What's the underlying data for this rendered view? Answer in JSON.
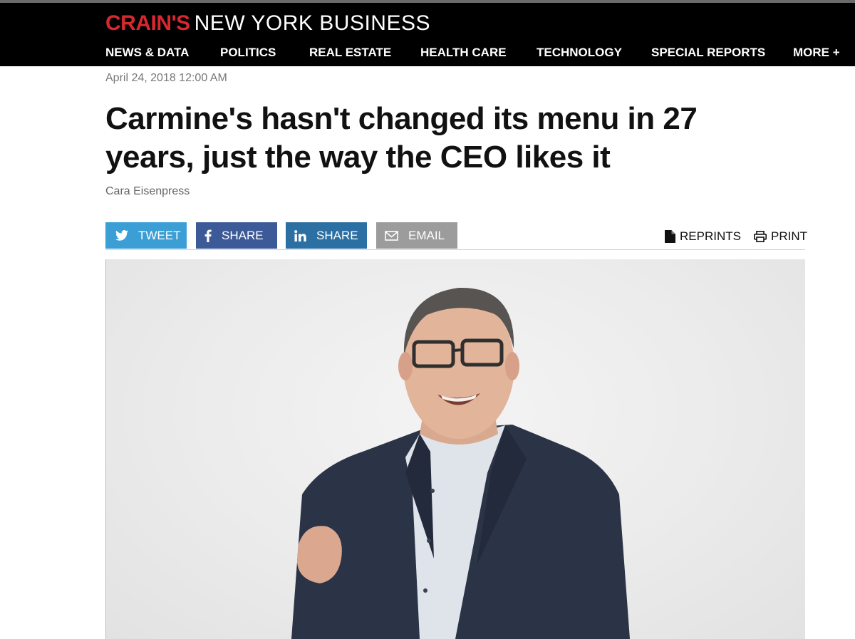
{
  "brand": {
    "name_bold": "CRAIN'S",
    "name_rest": "NEW YORK BUSINESS"
  },
  "nav": {
    "items": [
      "NEWS & DATA",
      "POLITICS",
      "REAL ESTATE",
      "HEALTH CARE",
      "TECHNOLOGY",
      "SPECIAL REPORTS",
      "MORE +"
    ]
  },
  "article": {
    "date": "April 24, 2018 12:00 AM",
    "headline": "Carmine's hasn't changed its menu in 27 years, just the way the CEO likes it",
    "author": "Cara Eisenpress"
  },
  "share": {
    "tweet": "TWEET",
    "facebook": "SHARE",
    "linkedin": "SHARE",
    "email": "EMAIL"
  },
  "tools": {
    "reprints": "REPRINTS",
    "print": "PRINT"
  },
  "icons": {
    "twitter": "twitter-icon",
    "facebook": "facebook-icon",
    "linkedin": "linkedin-icon",
    "email": "envelope-icon",
    "reprints": "document-icon",
    "print": "printer-icon"
  },
  "colors": {
    "brand_red": "#d7282f",
    "header_bg": "#000000",
    "twitter": "#3b9fd6",
    "facebook": "#3d5a98",
    "linkedin": "#2b6fa3",
    "email": "#9c9c9c"
  }
}
